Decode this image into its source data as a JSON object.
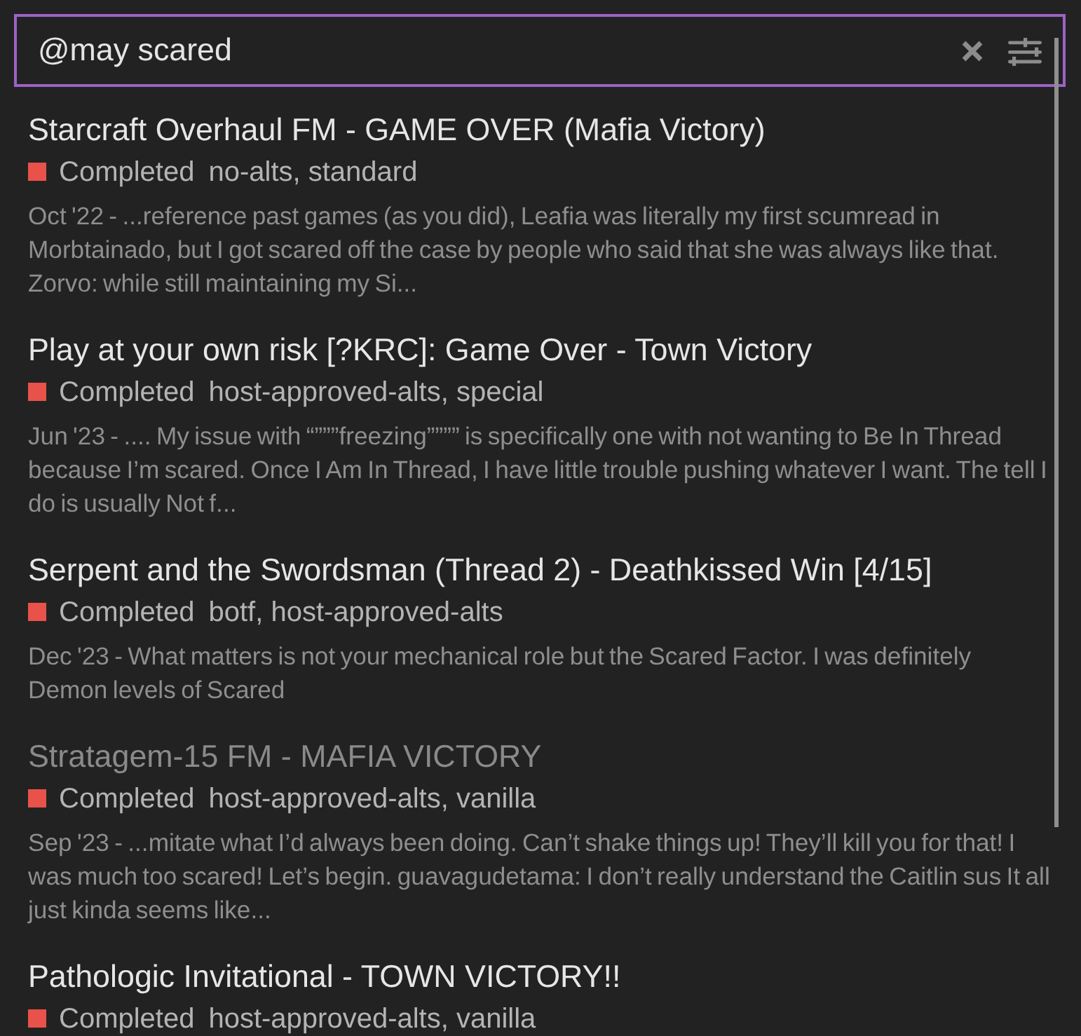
{
  "search": {
    "value": "@may scared"
  },
  "results": [
    {
      "title": "Starcraft Overhaul FM - GAME OVER (Mafia Victory)",
      "visited": false,
      "status": {
        "label": "Completed",
        "color": "#e9524a"
      },
      "tags": "no-alts, standard",
      "snippet": "Oct '22 - ...reference past games (as you did), Leafia was literally my first scumread in Morbtainado, but I got scared off the case by people who said that she was always like that. Zorvo: while still maintaining my Si..."
    },
    {
      "title": "Play at your own risk [?KRC]: Game Over - Town Victory",
      "visited": false,
      "status": {
        "label": "Completed",
        "color": "#e9524a"
      },
      "tags": "host-approved-alts, special",
      "snippet": "Jun '23 - .... My issue with “”””freezing”””” is specifically one with not wanting to Be In Thread because I’m scared. Once I Am In Thread, I have little trouble pushing whatever I want. The tell I do is usually Not f..."
    },
    {
      "title": "Serpent and the Swordsman (Thread 2) - Deathkissed Win [4/15]",
      "visited": false,
      "status": {
        "label": "Completed",
        "color": "#e9524a"
      },
      "tags": "botf, host-approved-alts",
      "snippet": "Dec '23 - What matters is not your mechanical role but the Scared Factor. I was definitely Demon levels of Scared"
    },
    {
      "title": "Stratagem-15 FM - MAFIA VICTORY",
      "visited": true,
      "status": {
        "label": "Completed",
        "color": "#e9524a"
      },
      "tags": "host-approved-alts, vanilla",
      "snippet": "Sep '23 - ...mitate what I’d always been doing. Can’t shake things up! They’ll kill you for that! I was much too scared! Let’s begin. guavagudetama: I don’t really understand the Caitlin sus It all just kinda seems like..."
    },
    {
      "title": "Pathologic Invitational - TOWN VICTORY!!",
      "visited": false,
      "status": {
        "label": "Completed",
        "color": "#e9524a"
      },
      "tags": "host-approved-alts, vanilla"
    }
  ]
}
